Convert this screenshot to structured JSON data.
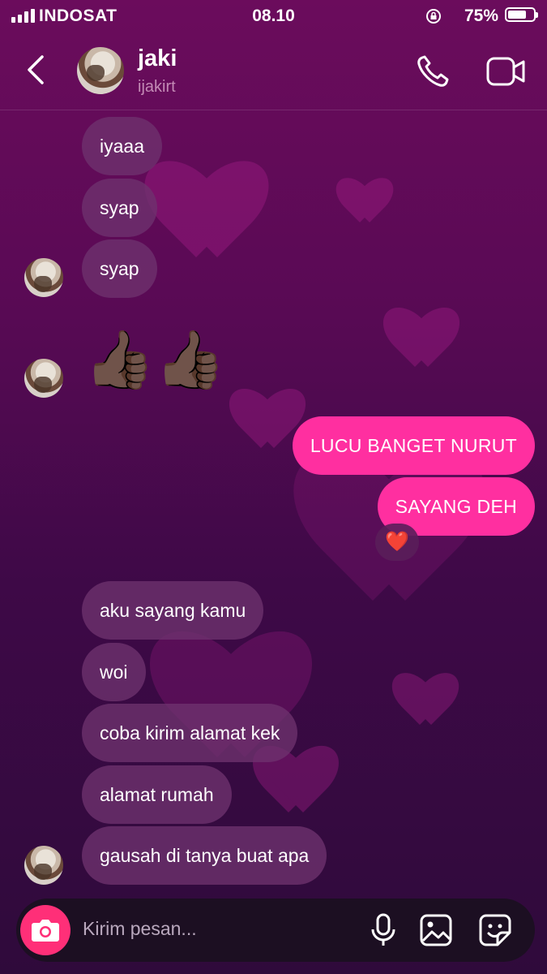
{
  "status_bar": {
    "carrier": "INDOSAT",
    "time": "08.10",
    "battery": "75%",
    "battery_level": 0.75
  },
  "header": {
    "name": "jaki",
    "username": "ijakirt"
  },
  "messages": {
    "m1": "iyaaa",
    "m2": "syap",
    "m3": "syap",
    "thumbs": "👍🏿👍🏿",
    "out1": "LUCU BANGET NURUT",
    "out2": "SAYANG DEH",
    "reaction": "❤️",
    "m4": "aku sayang kamu",
    "m5": "woi",
    "m6": "coba kirim alamat kek",
    "m7": "alamat rumah",
    "m8": "gausah di tanya buat apa"
  },
  "composer": {
    "placeholder": "Kirim pesan..."
  },
  "icons": [
    "back-chevron-icon",
    "phone-icon",
    "video-camera-icon",
    "camera-icon",
    "microphone-icon",
    "gallery-icon",
    "sticker-icon"
  ],
  "colors": {
    "outgoing_bubble": "#ff2fa0",
    "incoming_bubble": "#6e326e",
    "camera_button": "#ff2f78"
  }
}
